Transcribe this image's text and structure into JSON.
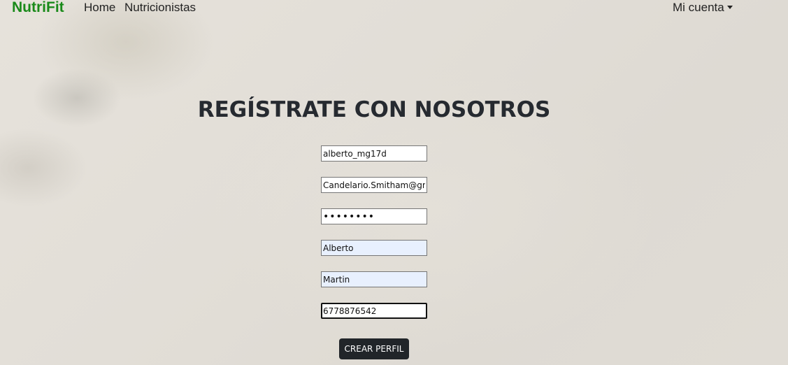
{
  "navbar": {
    "brand": "NutriFit",
    "links": [
      {
        "label": "Home"
      },
      {
        "label": "Nutricionistas"
      }
    ],
    "account_label": "Mi cuenta"
  },
  "form": {
    "title": "REGÍSTRATE CON NOSOTROS",
    "fields": {
      "username": "alberto_mg17d",
      "email": "Candelario.Smitham@gmail.com",
      "password": "abcdefgh",
      "first_name": "Alberto",
      "last_name": "Martin",
      "phone": "6778876542"
    },
    "submit_label": "CREAR PERFIL"
  },
  "colors": {
    "brand": "#1a8a1a",
    "button": "#212529",
    "autofill": "#e8f0fe"
  }
}
